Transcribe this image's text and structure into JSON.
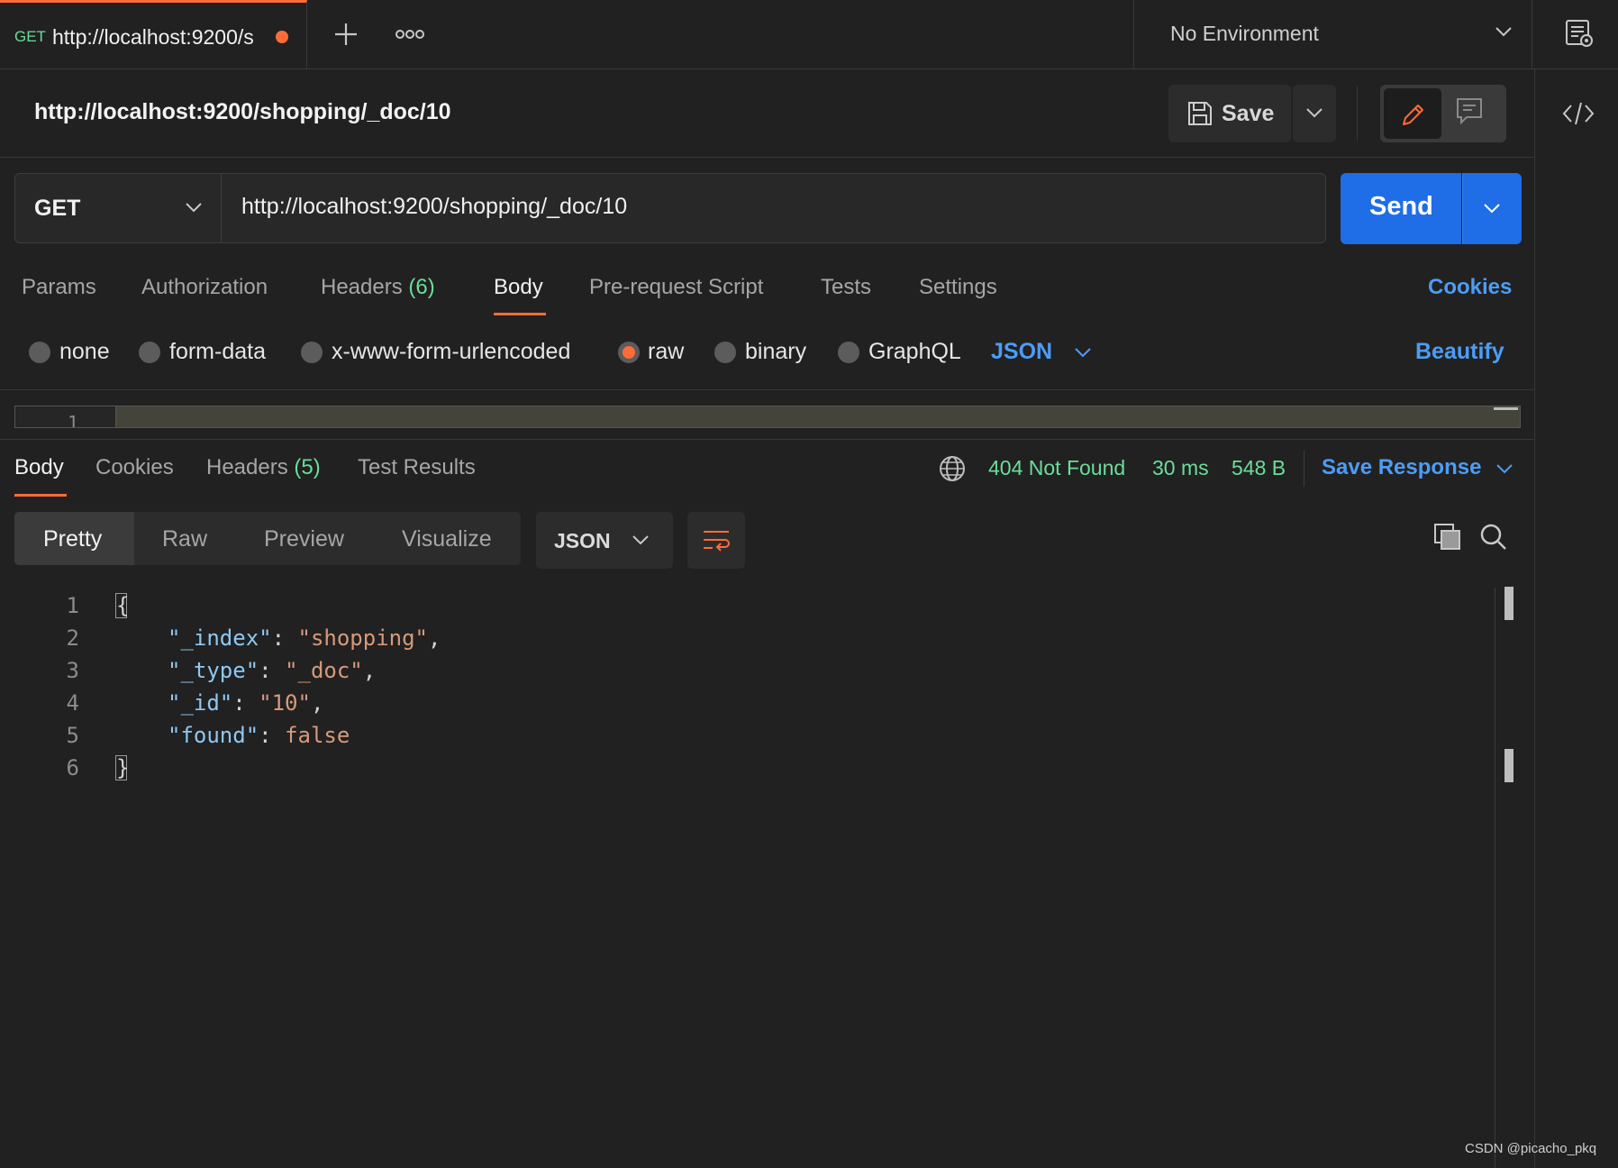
{
  "tabbar": {
    "active_tab": {
      "method": "GET",
      "title": "http://localhost:9200/s"
    },
    "environment": "No Environment"
  },
  "request": {
    "name": "http://localhost:9200/shopping/_doc/10",
    "save_label": "Save",
    "method": "GET",
    "url": "http://localhost:9200/shopping/_doc/10",
    "send_label": "Send",
    "tabs": [
      {
        "label": "Params"
      },
      {
        "label": "Authorization"
      },
      {
        "label": "Headers",
        "count": "(6)"
      },
      {
        "label": "Body"
      },
      {
        "label": "Pre-request Script"
      },
      {
        "label": "Tests"
      },
      {
        "label": "Settings"
      }
    ],
    "active_tab": "Body",
    "cookies_label": "Cookies",
    "body_types": [
      "none",
      "form-data",
      "x-www-form-urlencoded",
      "raw",
      "binary",
      "GraphQL"
    ],
    "selected_body_type": "raw",
    "body_language": "JSON",
    "beautify_label": "Beautify",
    "editor_line": "1"
  },
  "response": {
    "tabs": [
      {
        "label": "Body"
      },
      {
        "label": "Cookies"
      },
      {
        "label": "Headers",
        "count": "(5)"
      },
      {
        "label": "Test Results"
      }
    ],
    "active_tab": "Body",
    "status": "404 Not Found",
    "time": "30 ms",
    "size": "548 B",
    "save_response_label": "Save Response",
    "formats": [
      "Pretty",
      "Raw",
      "Preview",
      "Visualize"
    ],
    "active_format": "Pretty",
    "language": "JSON",
    "code": {
      "line_numbers": [
        "1",
        "2",
        "3",
        "4",
        "5",
        "6"
      ],
      "open_brace": "{",
      "close_brace": "}",
      "fields": [
        {
          "key": "\"_index\"",
          "value": "\"shopping\"",
          "comma": ","
        },
        {
          "key": "\"_type\"",
          "value": "\"_doc\"",
          "comma": ","
        },
        {
          "key": "\"_id\"",
          "value": "\"10\"",
          "comma": ","
        },
        {
          "key": "\"found\"",
          "value": "false",
          "comma": ""
        }
      ]
    }
  },
  "watermark": "CSDN @picacho_pkq",
  "colors": {
    "accent_orange": "#ff6c37",
    "send_blue": "#1f6de7",
    "link_blue": "#4d9cf5",
    "status_green": "#6bdd9a",
    "background": "#212121"
  },
  "icons": [
    "plus-icon",
    "more-icon",
    "chevron-down-icon",
    "environment-quicklook-icon",
    "code-icon",
    "save-icon",
    "pencil-icon",
    "comment-icon",
    "globe-icon",
    "wrap-lines-icon",
    "copy-icon",
    "search-icon"
  ]
}
